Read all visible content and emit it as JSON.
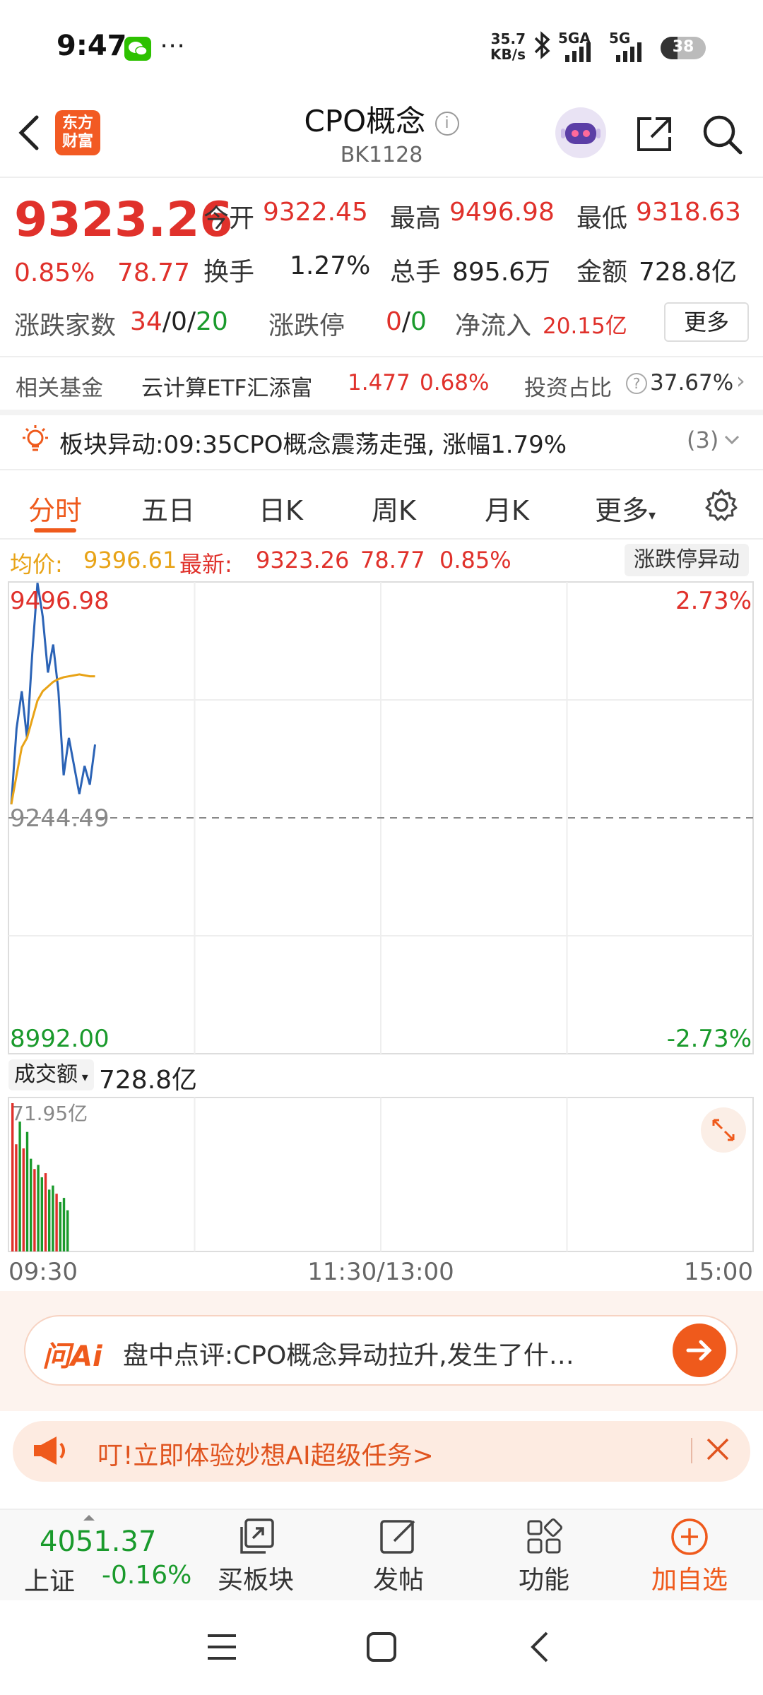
{
  "status_bar": {
    "time": "9:47",
    "net_speed_top": "35.7",
    "net_speed_bottom": "KB/s",
    "sim1_label": "5GA",
    "sim2_label": "5G",
    "battery": "38"
  },
  "header": {
    "logo_line1": "东方",
    "logo_line2": "财富",
    "title": "CPO概念",
    "code": "BK1128"
  },
  "quote": {
    "price": "9323.26",
    "change_pct": "0.85%",
    "change_amt": "78.77",
    "open_label": "今开",
    "open": "9322.45",
    "high_label": "最高",
    "high": "9496.98",
    "low_label": "最低",
    "low": "9318.63",
    "turnover_label": "换手",
    "turnover": "1.27%",
    "volume_label": "总手",
    "volume": "895.6万",
    "amount_label": "金额",
    "amount": "728.8亿",
    "updown_label": "涨跌家数",
    "up_count": "34",
    "flat_count": "0",
    "down_count": "20",
    "limit_label": "涨跌停",
    "limit_up": "0",
    "limit_down": "0",
    "netflow_label": "净流入",
    "netflow": "20.15亿",
    "more_label": "更多"
  },
  "fund": {
    "label": "相关基金",
    "name": "云计算ETF汇添富",
    "price": "1.477",
    "pct": "0.68%",
    "ratio_label": "投资占比",
    "ratio": "37.67%"
  },
  "alert": {
    "label": "板块异动:",
    "text": "09:35CPO概念震荡走强, 涨幅1.79%",
    "count": "(3)"
  },
  "tabs": [
    "分时",
    "五日",
    "日K",
    "周K",
    "月K",
    "更多"
  ],
  "chart_info": {
    "avg_label": "均价:",
    "avg": "9396.61",
    "latest_label": "最新:",
    "latest": "9323.26",
    "chg": "78.77",
    "pct": "0.85%",
    "limit_btn": "涨跌停异动"
  },
  "chart_data": {
    "type": "line",
    "price_ticks": {
      "top": "9496.98",
      "mid": "9244.49",
      "bottom": "8992.00"
    },
    "pct_ticks": {
      "top": "2.73%",
      "bottom": "-2.73%"
    },
    "time_ticks": [
      "09:30",
      "11:30/13:00",
      "15:00"
    ],
    "ylim": [
      8992.0,
      9496.98
    ],
    "series": [
      {
        "values": [
          9259,
          9340,
          9380,
          9330,
          9420,
          9496,
          9460,
          9400,
          9430,
          9380,
          9290,
          9330,
          9300,
          9270,
          9300,
          9280,
          9323
        ]
      },
      {
        "values": [
          9259,
          9290,
          9320,
          9330,
          9350,
          9370,
          9380,
          9385,
          9390,
          9393,
          9395,
          9396,
          9397,
          9398,
          9397,
          9396,
          9396
        ]
      }
    ],
    "volume_label": "成交额",
    "volume_total": "728.8亿",
    "volume_max": "71.95亿",
    "volume": [
      {
        "v": 71.95,
        "up": true
      },
      {
        "v": 52,
        "up": true
      },
      {
        "v": 63,
        "up": false
      },
      {
        "v": 50,
        "up": true
      },
      {
        "v": 58,
        "up": false
      },
      {
        "v": 45,
        "up": false
      },
      {
        "v": 40,
        "up": true
      },
      {
        "v": 42,
        "up": false
      },
      {
        "v": 36,
        "up": false
      },
      {
        "v": 38,
        "up": true
      },
      {
        "v": 30,
        "up": false
      },
      {
        "v": 32,
        "up": false
      },
      {
        "v": 28,
        "up": true
      },
      {
        "v": 24,
        "up": false
      },
      {
        "v": 26,
        "up": false
      },
      {
        "v": 20,
        "up": false
      }
    ]
  },
  "ai": {
    "logo": "问Ai",
    "text": "盘中点评:CPO概念异动拉升,发生了什…"
  },
  "promo": {
    "text": "叮!立即体验妙想AI超级任务>"
  },
  "bottom": {
    "index_value": "4051.37",
    "index_name": "上证",
    "index_change": "-0.16%",
    "buy_label": "买板块",
    "post_label": "发帖",
    "func_label": "功能",
    "fav_label": "加自选"
  },
  "colors": {
    "red": "#e0312b",
    "green": "#1a9a2c",
    "accent": "#ef5a1c"
  }
}
